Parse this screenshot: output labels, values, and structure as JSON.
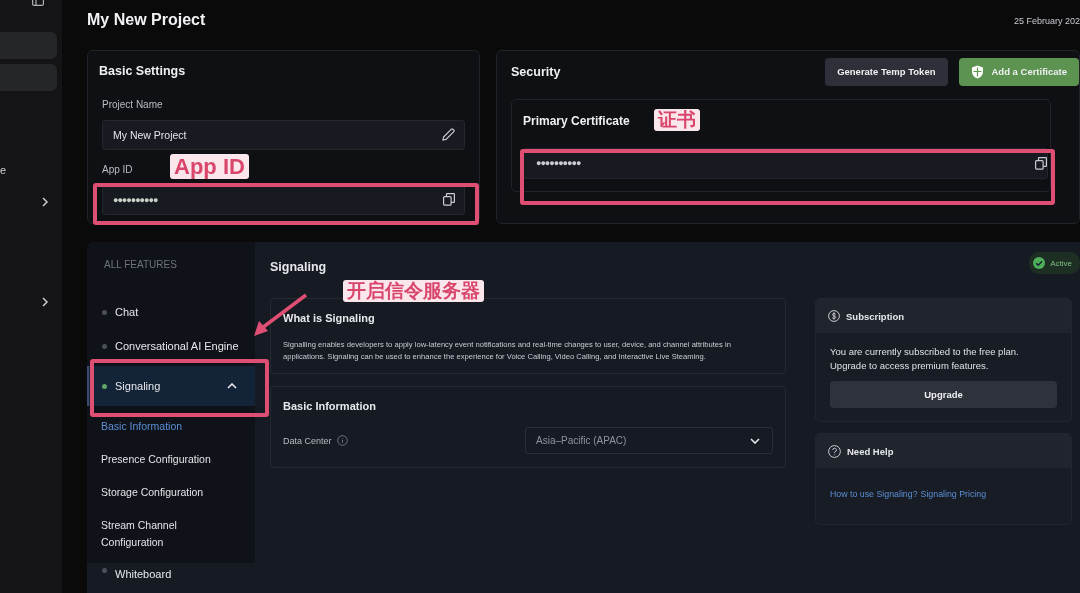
{
  "sidebar": {
    "items": [
      {
        "text": "e"
      }
    ]
  },
  "header": {
    "title": "My New Project",
    "date": "25 February 202"
  },
  "basic_settings": {
    "title": "Basic Settings",
    "fields": [
      {
        "label": "Project Name",
        "value": "My New Project",
        "kind": "edit"
      },
      {
        "label": "App ID",
        "value": "●●●●●●●●●●",
        "kind": "copy"
      }
    ]
  },
  "security": {
    "title": "Security",
    "buttons": [
      {
        "label": "Generate Temp Token",
        "kind": "secondary"
      },
      {
        "label": "Add a Certificate",
        "kind": "primary"
      }
    ],
    "certificate": {
      "title": "Primary Certificate",
      "value": "●●●●●●●●●●"
    }
  },
  "features": {
    "heading": "ALL FEATURES",
    "items": [
      {
        "label": "Chat",
        "selected": false,
        "color": "#4a4f58"
      },
      {
        "label": "Conversational AI Engine",
        "selected": false,
        "color": "#4a4f58"
      },
      {
        "label": "Signaling",
        "selected": true,
        "color": "#5fa865",
        "expanded": true,
        "children": [
          {
            "label": "Basic Information",
            "selected": true
          },
          {
            "label": "Presence Configuration",
            "selected": false
          },
          {
            "label": "Storage Configuration",
            "selected": false
          },
          {
            "label": "Stream Channel Configuration",
            "selected": false
          }
        ]
      },
      {
        "label": "Whiteboard",
        "selected": false,
        "color": "#4a4f58"
      }
    ]
  },
  "signaling": {
    "title": "Signaling",
    "status": "Active",
    "sections": [
      {
        "kind": "text",
        "title": "What is Signaling",
        "body": "Signalling enables developers to apply low-latency event notifications and real-time changes to user, device, and channel attributes in applications. Signaling can be used to enhance the experience for Voice Calling, Video Calling, and Interactive Live Steaming."
      },
      {
        "kind": "form",
        "title": "Basic Information",
        "label": "Data Center",
        "value": "Asia–Pacific (APAC)"
      }
    ],
    "subscription": {
      "title": "Subscription",
      "body": "You are currently subscribed to the free plan. Upgrade to access premium features.",
      "button": "Upgrade"
    },
    "help": {
      "title": "Need Help",
      "links": [
        "How to use Signaling?",
        "Signaling Pricing"
      ]
    }
  },
  "annotations": [
    {
      "kind": "app_id",
      "text": "App ID"
    },
    {
      "kind": "certificate",
      "text": "证书"
    },
    {
      "kind": "feature",
      "text": "开启信令服务器"
    }
  ]
}
